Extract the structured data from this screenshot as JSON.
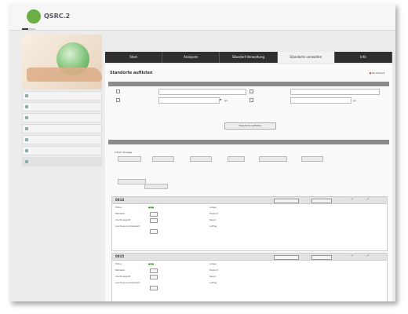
{
  "brand": {
    "name": "QSRC.2"
  },
  "top_tabs": [
    "",
    ""
  ],
  "utility": {
    "texts": [
      "",
      "",
      "",
      "",
      ""
    ]
  },
  "sidebar": {
    "items": [
      {
        "label": ""
      },
      {
        "label": ""
      },
      {
        "label": ""
      },
      {
        "label": ""
      },
      {
        "label": ""
      },
      {
        "label": ""
      },
      {
        "label": ""
      }
    ]
  },
  "nav": {
    "items": [
      {
        "label": "Start"
      },
      {
        "label": "Analysen"
      },
      {
        "label": "Standort-Verwaltung"
      },
      {
        "label": "Standorte verwalten",
        "active": true
      },
      {
        "label": "Info"
      }
    ]
  },
  "page": {
    "title": "Standorte auflisten",
    "export": "Ex-/Import"
  },
  "filter": {
    "bar": "",
    "fields": [
      {
        "label": ""
      },
      {
        "label": ""
      },
      {
        "label": ""
      },
      {
        "label": ""
      }
    ],
    "go1": "go",
    "go2": "go",
    "submit": "Standorte auflisten"
  },
  "results": {
    "bar": "",
    "filter_toggle": "Zum Anzeige",
    "pills": [
      "",
      "",
      "",
      "",
      "",
      ""
    ],
    "tab_labels": [
      "",
      ""
    ]
  },
  "cards": [
    {
      "id": "0014",
      "left_labels": [
        "Status",
        "Betrieben",
        "Anschlussgerät",
        "Anschluss-Anschlusswert"
      ],
      "center_labels": [
        "Anlage",
        "Standort",
        "Region",
        "Auftrag"
      ],
      "center_values": [
        "",
        "",
        ""
      ],
      "right_values": [
        "",
        "",
        ""
      ],
      "links": ""
    },
    {
      "id": "0015",
      "left_labels": [
        "Status",
        "Betrieben",
        "Anschlussgerät",
        "Anschluss-Anschlusswert"
      ],
      "center_labels": [
        "Anlage",
        "Standort",
        "Region",
        "Auftrag"
      ],
      "center_values": [
        "",
        "",
        ""
      ],
      "right_values": [
        "",
        "",
        ""
      ],
      "links": ""
    }
  ],
  "colors": {
    "nav_bg": "#2f2f2f",
    "accent_green": "#6cae46",
    "link_red": "#cc3333"
  }
}
